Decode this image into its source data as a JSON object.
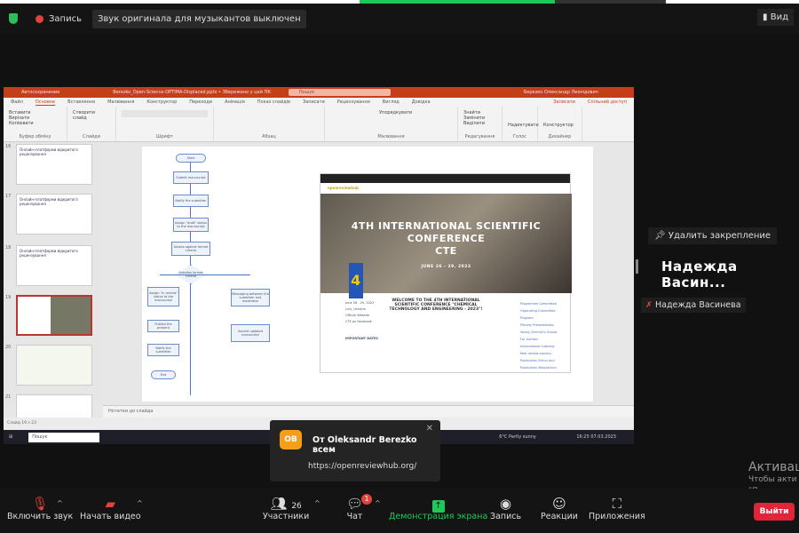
{
  "topbar": {
    "record_label": "Запись",
    "banner": "Звук оригинала для музыкантов выключен",
    "view_label": "Вид"
  },
  "ppt": {
    "autosave": "Автосохранение",
    "filename": "Berezko_Open-Science-OPTIMA-Displaced.pptx • Збережено у цей ПК",
    "search": "Пошук",
    "user": "Березко Олександр Леонідович",
    "tabs": [
      "Файл",
      "Основне",
      "Вставлення",
      "Малювання",
      "Конструктор",
      "Переходи",
      "Анімація",
      "Показ слайдів",
      "Записати",
      "Рецензування",
      "Вигляд",
      "Довідка"
    ],
    "groups": [
      "Буфер обміну",
      "Слайди",
      "Шрифт",
      "Абзац",
      "Малювання",
      "Редагування",
      "Голос",
      "Дизайнер"
    ],
    "buttons": {
      "paste": "Вставити",
      "cut": "Вирізати",
      "copy": "Копіювати",
      "format": "Формат за зразком",
      "new_slide": "Створити слайд",
      "arrange": "Упорядкувати",
      "find": "Знайти",
      "replace": "Замінити",
      "select": "Виділити",
      "dictate": "Надиктувати",
      "designer": "Конструктор",
      "record": "Записати",
      "share": "Спільний доступ"
    },
    "thumbs": [
      {
        "num": "16",
        "title": "Онлайн-платформи відкритого рецензування"
      },
      {
        "num": "17",
        "title": "Онлайн-платформи відкритого рецензування"
      },
      {
        "num": "18",
        "title": "Онлайн-платформи відкритого рецензування"
      },
      {
        "num": "19",
        "title": ""
      },
      {
        "num": "20",
        "title": ""
      },
      {
        "num": "21",
        "title": ""
      }
    ],
    "notes": "Нотатки до слайда",
    "status": "Слайд 19 з 23",
    "taskbar_search": "Пошук",
    "weather": "6°C Partly sunny",
    "clock": "16:25 07.03.2023"
  },
  "flowchart": [
    "Start",
    "Submit manuscript",
    "Notify the submitter",
    "Assign \"draft\" status to the manuscript",
    "Assess against format criteria",
    "Satisfies format criteria",
    "Assign \"in review\" status to the manuscript",
    "Publish the preprint",
    "Notify the submitter",
    "End",
    "Messaging between the submitter and moderator",
    "Submit updated manuscript"
  ],
  "website": {
    "logo": "openreviewhub",
    "hero_title": [
      "4TH INTERNATIONAL SCIENTIFIC",
      "CONFERENCE",
      "CTE"
    ],
    "hero_dates": "JUNE 26 - 29, 2023",
    "welcome": "WELCOME TO THE 4TH INTERNATIONAL SCIENTIFIC CONFERENCE \"CHEMICAL TECHNOLOGY AND ENGINEERING - 2023\"!",
    "important_dates": "IMPORTANT DATES",
    "left_items": [
      "June 26 - 29, 2023",
      "Lviv, Ukraine",
      "Official Website",
      "CTE on Facebook"
    ],
    "links": [
      "Programme Committee",
      "Organizing Committee",
      "Program",
      "Plenary Presentations",
      "Young Chemist's School",
      "For Authors",
      "International Indexing",
      "Peer-review process",
      "Publication Ethics and Publication Malpractice"
    ]
  },
  "pinned": {
    "unpin_label": "Удалить закрепление",
    "big_name": "Надежда  Васин...",
    "name_tag": "Надежда Васинева"
  },
  "chat_popup": {
    "avatar": "OB",
    "from": "От Oleksandr Berezko всем",
    "message": "https://openreviewhub.org/"
  },
  "watermark": {
    "line1": "Активац",
    "line2": "Чтобы акти",
    "line3": "\"Параметр"
  },
  "toolbar": {
    "unmute": "Включить звук",
    "start_video": "Начать видео",
    "participants": "Участники",
    "participants_count": "26",
    "chat": "Чат",
    "chat_badge": "1",
    "share": "Демонстрация экрана",
    "record": "Запись",
    "reactions": "Реакции",
    "apps": "Приложения",
    "leave": "Выйти"
  },
  "colors": {
    "ppt_accent": "#c43e1c",
    "share_green": "#1dc957",
    "leave_red": "#e0243a",
    "avatar_orange": "#f59f18"
  }
}
